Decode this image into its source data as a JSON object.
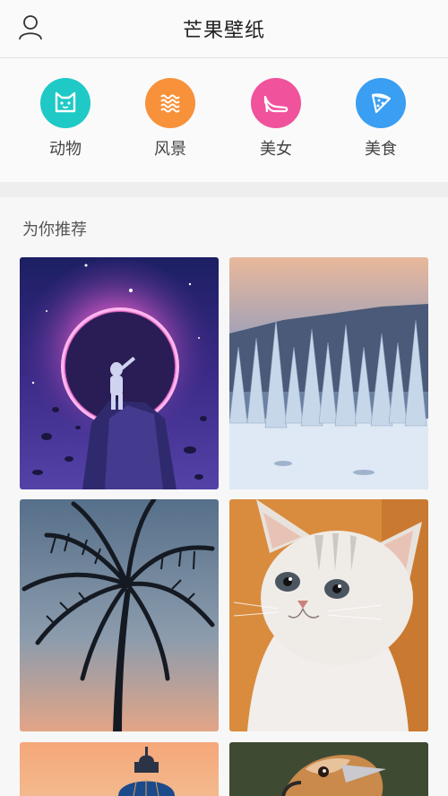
{
  "header": {
    "title": "芒果壁纸",
    "user_icon": "user-icon"
  },
  "categories": [
    {
      "label": "动物",
      "icon": "cat-face-icon",
      "color": "#1fc9c6"
    },
    {
      "label": "风景",
      "icon": "waves-icon",
      "color": "#f7913a"
    },
    {
      "label": "美女",
      "icon": "high-heel-icon",
      "color": "#f0529c"
    },
    {
      "label": "美食",
      "icon": "pizza-slice-icon",
      "color": "#3a9ef2"
    }
  ],
  "recommend": {
    "title": "为你推荐",
    "wallpapers": [
      {
        "subject": "astronaut-planet"
      },
      {
        "subject": "snowy-forest"
      },
      {
        "subject": "palm-tree"
      },
      {
        "subject": "kitten"
      },
      {
        "subject": "dome-sunset"
      },
      {
        "subject": "bird"
      }
    ]
  }
}
